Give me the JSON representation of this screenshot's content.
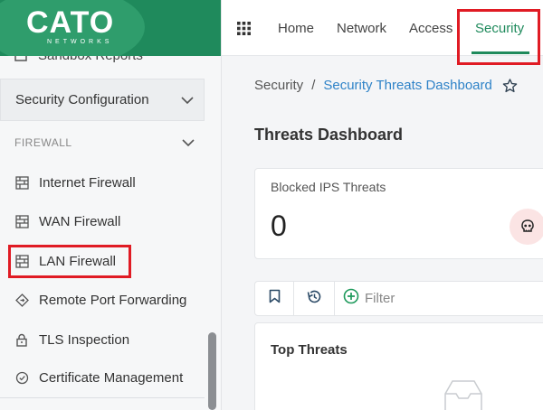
{
  "brand": {
    "name": "CATO",
    "tagline": "NETWORKS"
  },
  "sidebar": {
    "partial_item": "Sandbox Reports",
    "section_header": "Security Configuration",
    "group_label": "FIREWALL",
    "items": [
      {
        "label": "Internet Firewall",
        "icon": "firewall-icon"
      },
      {
        "label": "WAN Firewall",
        "icon": "firewall-icon"
      },
      {
        "label": "LAN Firewall",
        "icon": "firewall-icon"
      },
      {
        "label": "Remote Port Forwarding",
        "icon": "diamond-arrow-icon"
      },
      {
        "label": "TLS Inspection",
        "icon": "lock-icon"
      },
      {
        "label": "Certificate Management",
        "icon": "badge-check-icon"
      }
    ]
  },
  "topnav": {
    "tabs": [
      "Home",
      "Network",
      "Access",
      "Security"
    ],
    "active_tab": "Security"
  },
  "breadcrumb": {
    "root": "Security",
    "separator": "/",
    "current": "Security Threats Dashboard"
  },
  "page": {
    "title": "Threats Dashboard"
  },
  "cards": {
    "blocked_ips": {
      "title": "Blocked IPS Threats",
      "value": "0"
    },
    "top_threats": {
      "title": "Top Threats"
    }
  },
  "toolbar": {
    "filter_label": "Filter"
  },
  "colors": {
    "brand_green": "#1f8a5c",
    "link_blue": "#2f83c8",
    "highlight_red": "#e01b24"
  }
}
